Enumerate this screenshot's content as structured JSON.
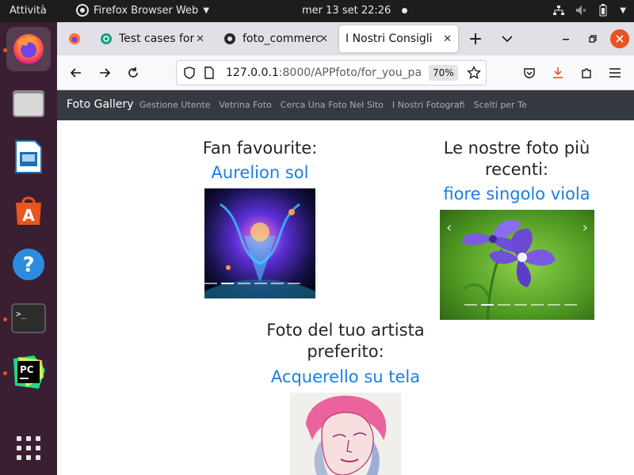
{
  "topbar": {
    "activities": "Attività",
    "app_name": "Firefox Browser Web",
    "clock": "mer 13 set  22:26"
  },
  "dock": {
    "apps": [
      "firefox",
      "files",
      "libreoffice-impress",
      "app-center",
      "help",
      "terminal",
      "pycharm",
      "show-apps"
    ]
  },
  "browser": {
    "tabs": [
      {
        "title": "Test cases for",
        "icon": "chatgpt-icon"
      },
      {
        "title": "foto_commerc",
        "icon": "github-icon"
      },
      {
        "title": "I Nostri Consigli",
        "icon": ""
      }
    ],
    "url_host": "127.0.0.1",
    "url_rest": ":8000/APPfoto/for_you_pa",
    "zoom": "70%"
  },
  "site": {
    "brand": "Foto Gallery",
    "nav": [
      "Gestione Utente",
      "Vetrina Foto",
      "Cerca Una Foto Nel Sito",
      "I Nostri Fotografi",
      "Scelti per Te"
    ]
  },
  "sections": {
    "fan_title": "Fan favourite:",
    "fan_photo": "Aurelion sol",
    "recent_title_1": "Le nostre foto più",
    "recent_title_2": "recenti:",
    "recent_photo": "fiore singolo viola",
    "artist_title_1": "Foto del tuo artista",
    "artist_title_2": "preferito:",
    "artist_photo": "Acquerello su tela"
  },
  "colors": {
    "link": "#1a7ee6",
    "navbar": "#343a40",
    "dock": "#3a1f33",
    "ubuntu_orange": "#e95420"
  }
}
